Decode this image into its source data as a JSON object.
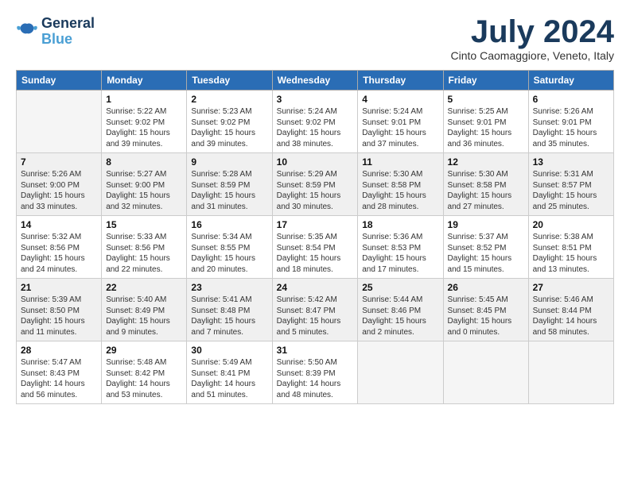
{
  "logo": {
    "line1": "General",
    "line2": "Blue"
  },
  "title": "July 2024",
  "subtitle": "Cinto Caomaggiore, Veneto, Italy",
  "headers": [
    "Sunday",
    "Monday",
    "Tuesday",
    "Wednesday",
    "Thursday",
    "Friday",
    "Saturday"
  ],
  "weeks": [
    [
      {
        "num": "",
        "info": "",
        "empty": true
      },
      {
        "num": "1",
        "info": "Sunrise: 5:22 AM\nSunset: 9:02 PM\nDaylight: 15 hours\nand 39 minutes."
      },
      {
        "num": "2",
        "info": "Sunrise: 5:23 AM\nSunset: 9:02 PM\nDaylight: 15 hours\nand 39 minutes."
      },
      {
        "num": "3",
        "info": "Sunrise: 5:24 AM\nSunset: 9:02 PM\nDaylight: 15 hours\nand 38 minutes."
      },
      {
        "num": "4",
        "info": "Sunrise: 5:24 AM\nSunset: 9:01 PM\nDaylight: 15 hours\nand 37 minutes."
      },
      {
        "num": "5",
        "info": "Sunrise: 5:25 AM\nSunset: 9:01 PM\nDaylight: 15 hours\nand 36 minutes."
      },
      {
        "num": "6",
        "info": "Sunrise: 5:26 AM\nSunset: 9:01 PM\nDaylight: 15 hours\nand 35 minutes."
      }
    ],
    [
      {
        "num": "7",
        "info": "Sunrise: 5:26 AM\nSunset: 9:00 PM\nDaylight: 15 hours\nand 33 minutes."
      },
      {
        "num": "8",
        "info": "Sunrise: 5:27 AM\nSunset: 9:00 PM\nDaylight: 15 hours\nand 32 minutes."
      },
      {
        "num": "9",
        "info": "Sunrise: 5:28 AM\nSunset: 8:59 PM\nDaylight: 15 hours\nand 31 minutes."
      },
      {
        "num": "10",
        "info": "Sunrise: 5:29 AM\nSunset: 8:59 PM\nDaylight: 15 hours\nand 30 minutes."
      },
      {
        "num": "11",
        "info": "Sunrise: 5:30 AM\nSunset: 8:58 PM\nDaylight: 15 hours\nand 28 minutes."
      },
      {
        "num": "12",
        "info": "Sunrise: 5:30 AM\nSunset: 8:58 PM\nDaylight: 15 hours\nand 27 minutes."
      },
      {
        "num": "13",
        "info": "Sunrise: 5:31 AM\nSunset: 8:57 PM\nDaylight: 15 hours\nand 25 minutes."
      }
    ],
    [
      {
        "num": "14",
        "info": "Sunrise: 5:32 AM\nSunset: 8:56 PM\nDaylight: 15 hours\nand 24 minutes."
      },
      {
        "num": "15",
        "info": "Sunrise: 5:33 AM\nSunset: 8:56 PM\nDaylight: 15 hours\nand 22 minutes."
      },
      {
        "num": "16",
        "info": "Sunrise: 5:34 AM\nSunset: 8:55 PM\nDaylight: 15 hours\nand 20 minutes."
      },
      {
        "num": "17",
        "info": "Sunrise: 5:35 AM\nSunset: 8:54 PM\nDaylight: 15 hours\nand 18 minutes."
      },
      {
        "num": "18",
        "info": "Sunrise: 5:36 AM\nSunset: 8:53 PM\nDaylight: 15 hours\nand 17 minutes."
      },
      {
        "num": "19",
        "info": "Sunrise: 5:37 AM\nSunset: 8:52 PM\nDaylight: 15 hours\nand 15 minutes."
      },
      {
        "num": "20",
        "info": "Sunrise: 5:38 AM\nSunset: 8:51 PM\nDaylight: 15 hours\nand 13 minutes."
      }
    ],
    [
      {
        "num": "21",
        "info": "Sunrise: 5:39 AM\nSunset: 8:50 PM\nDaylight: 15 hours\nand 11 minutes."
      },
      {
        "num": "22",
        "info": "Sunrise: 5:40 AM\nSunset: 8:49 PM\nDaylight: 15 hours\nand 9 minutes."
      },
      {
        "num": "23",
        "info": "Sunrise: 5:41 AM\nSunset: 8:48 PM\nDaylight: 15 hours\nand 7 minutes."
      },
      {
        "num": "24",
        "info": "Sunrise: 5:42 AM\nSunset: 8:47 PM\nDaylight: 15 hours\nand 5 minutes."
      },
      {
        "num": "25",
        "info": "Sunrise: 5:44 AM\nSunset: 8:46 PM\nDaylight: 15 hours\nand 2 minutes."
      },
      {
        "num": "26",
        "info": "Sunrise: 5:45 AM\nSunset: 8:45 PM\nDaylight: 15 hours\nand 0 minutes."
      },
      {
        "num": "27",
        "info": "Sunrise: 5:46 AM\nSunset: 8:44 PM\nDaylight: 14 hours\nand 58 minutes."
      }
    ],
    [
      {
        "num": "28",
        "info": "Sunrise: 5:47 AM\nSunset: 8:43 PM\nDaylight: 14 hours\nand 56 minutes."
      },
      {
        "num": "29",
        "info": "Sunrise: 5:48 AM\nSunset: 8:42 PM\nDaylight: 14 hours\nand 53 minutes."
      },
      {
        "num": "30",
        "info": "Sunrise: 5:49 AM\nSunset: 8:41 PM\nDaylight: 14 hours\nand 51 minutes."
      },
      {
        "num": "31",
        "info": "Sunrise: 5:50 AM\nSunset: 8:39 PM\nDaylight: 14 hours\nand 48 minutes."
      },
      {
        "num": "",
        "info": "",
        "empty": true
      },
      {
        "num": "",
        "info": "",
        "empty": true
      },
      {
        "num": "",
        "info": "",
        "empty": true
      }
    ]
  ]
}
